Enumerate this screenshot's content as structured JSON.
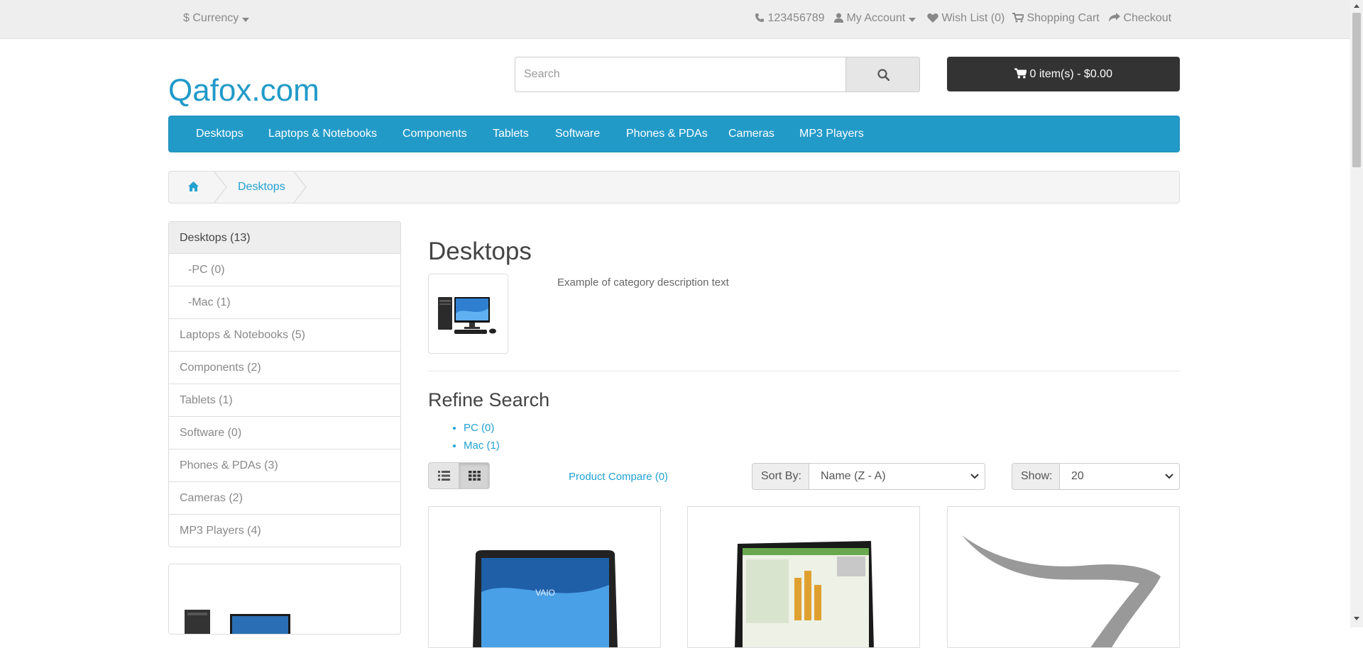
{
  "topbar": {
    "currency_label": "Currency",
    "phone": "123456789",
    "my_account": "My Account",
    "wish_list": "Wish List (0)",
    "shopping_cart": "Shopping Cart",
    "checkout": "Checkout"
  },
  "header": {
    "logo": "Qafox.com",
    "search_placeholder": "Search",
    "cart_label": "0 item(s) - $0.00"
  },
  "menu": {
    "items": [
      "Desktops",
      "Laptops & Notebooks",
      "Components",
      "Tablets",
      "Software",
      "Phones & PDAs",
      "Cameras",
      "MP3 Players"
    ]
  },
  "breadcrumb": {
    "current": "Desktops"
  },
  "sidebar": {
    "items": [
      {
        "label": "Desktops (13)"
      },
      {
        "label": "-PC (0)"
      },
      {
        "label": "-Mac (1)"
      },
      {
        "label": "Laptops & Notebooks (5)"
      },
      {
        "label": "Components (2)"
      },
      {
        "label": "Tablets (1)"
      },
      {
        "label": "Software (0)"
      },
      {
        "label": "Phones & PDAs (3)"
      },
      {
        "label": "Cameras (2)"
      },
      {
        "label": "MP3 Players (4)"
      }
    ]
  },
  "content": {
    "title": "Desktops",
    "description": "Example of category description text",
    "refine_title": "Refine Search",
    "refine_links": [
      "PC (0)",
      "Mac (1)"
    ],
    "product_compare": "Product Compare (0)",
    "sort_label": "Sort By:",
    "sort_value": "Name (Z - A)",
    "show_label": "Show:",
    "show_value": "20"
  },
  "colors": {
    "accent": "#229ac8",
    "link": "#23a1d1",
    "cart_bg": "#333333"
  }
}
